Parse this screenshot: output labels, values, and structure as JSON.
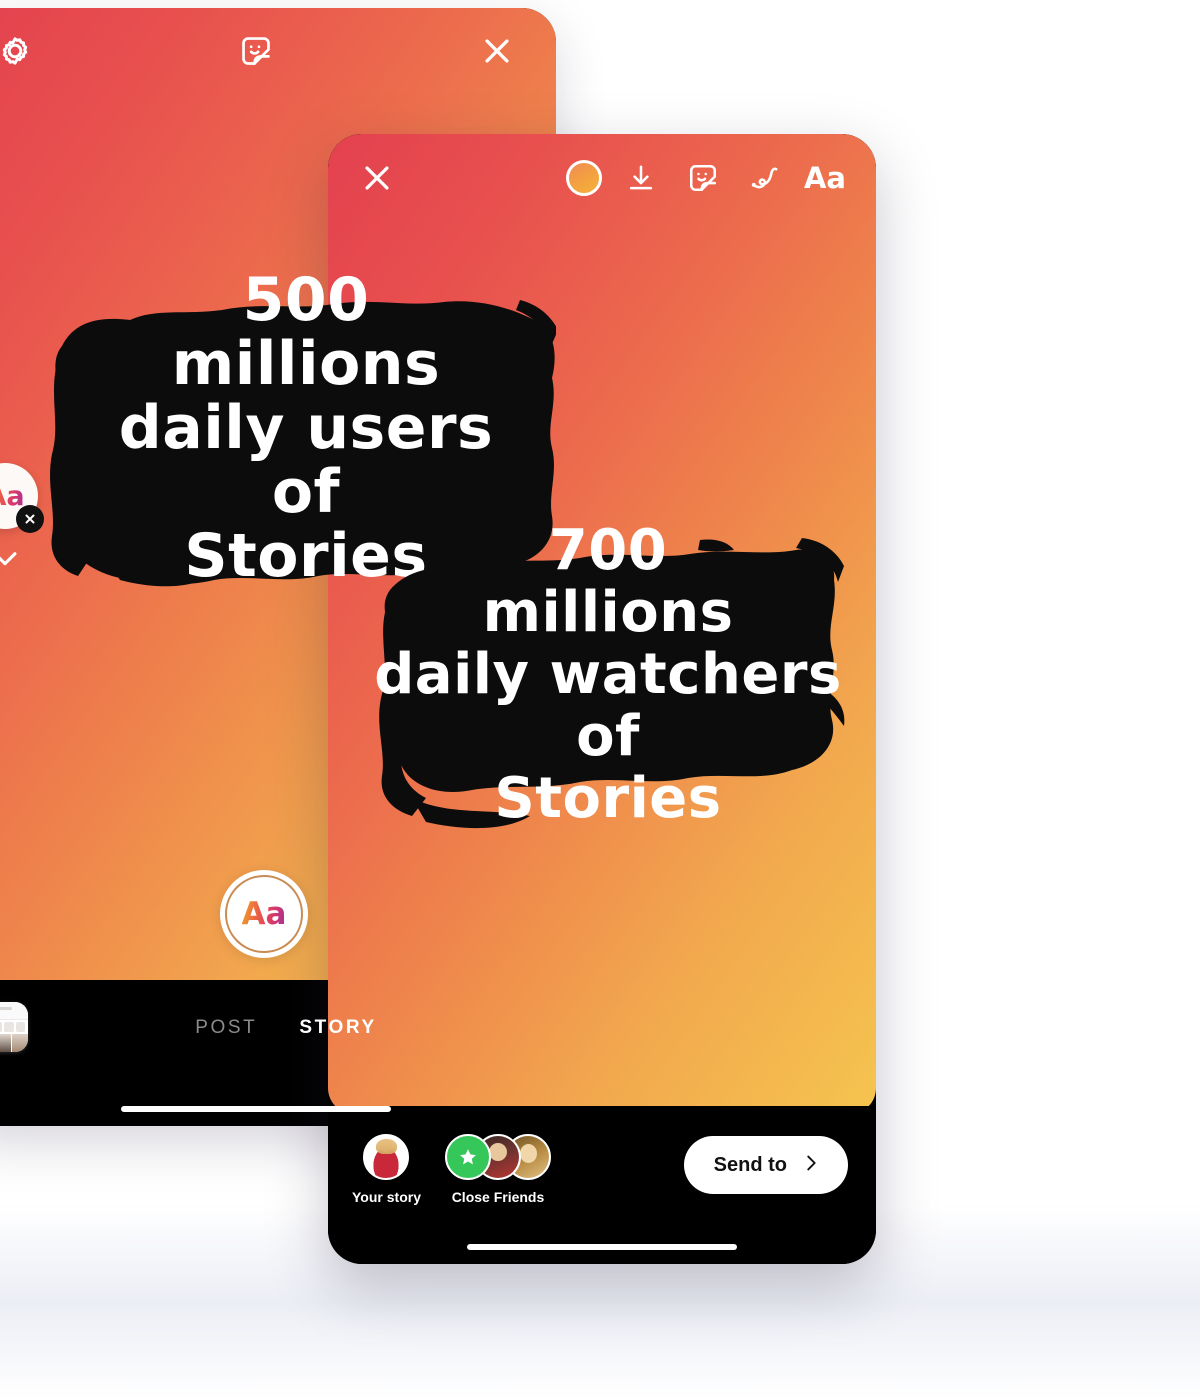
{
  "page": {
    "background": "#ffffff"
  },
  "back_phone": {
    "name": "instagram-story-editor-background",
    "topbar": {
      "settings_icon": "gear-icon",
      "sticker_icon": "sticker-icon",
      "close_icon": "close-icon"
    },
    "story_text": {
      "lines": [
        "500",
        "millions",
        "daily users",
        "of",
        "Stories"
      ],
      "text_color": "#ffffff",
      "brush_color": "#0c0c0c"
    },
    "text_tool": {
      "label": "Aa",
      "remove_icon": "close-icon",
      "chevron_icon": "chevron-down-icon"
    },
    "shutter": {
      "label": "Aa"
    },
    "bottom": {
      "gallery_icon": "gallery-thumbnail-icon",
      "tabs": [
        {
          "label": "POST",
          "active": false
        },
        {
          "label": "STORY",
          "active": true
        }
      ]
    },
    "gradient": {
      "from": "#e3414f",
      "to": "#f5c44f"
    }
  },
  "front_phone": {
    "name": "instagram-story-editor-foreground",
    "topbar": {
      "close_icon": "close-icon",
      "color_circle_icon": "color-picker-icon",
      "download_icon": "download-icon",
      "sticker_icon": "sticker-icon",
      "draw_icon": "draw-squiggle-icon",
      "text_label": "Aa"
    },
    "story_text": {
      "lines": [
        "700",
        "millions",
        "daily watchers",
        "of",
        "Stories"
      ],
      "text_color": "#ffffff",
      "brush_color": "#0c0c0c"
    },
    "bottom": {
      "share_targets": [
        {
          "label": "Your story",
          "avatar": "your-story-avatar"
        },
        {
          "label": "Close Friends",
          "avatar": "close-friends-avatars",
          "badge_icon": "star-icon"
        }
      ],
      "send_button": {
        "label": "Send to",
        "icon": "chevron-right-icon"
      }
    },
    "gradient": {
      "from": "#e3414f",
      "to": "#f5c44f"
    }
  }
}
